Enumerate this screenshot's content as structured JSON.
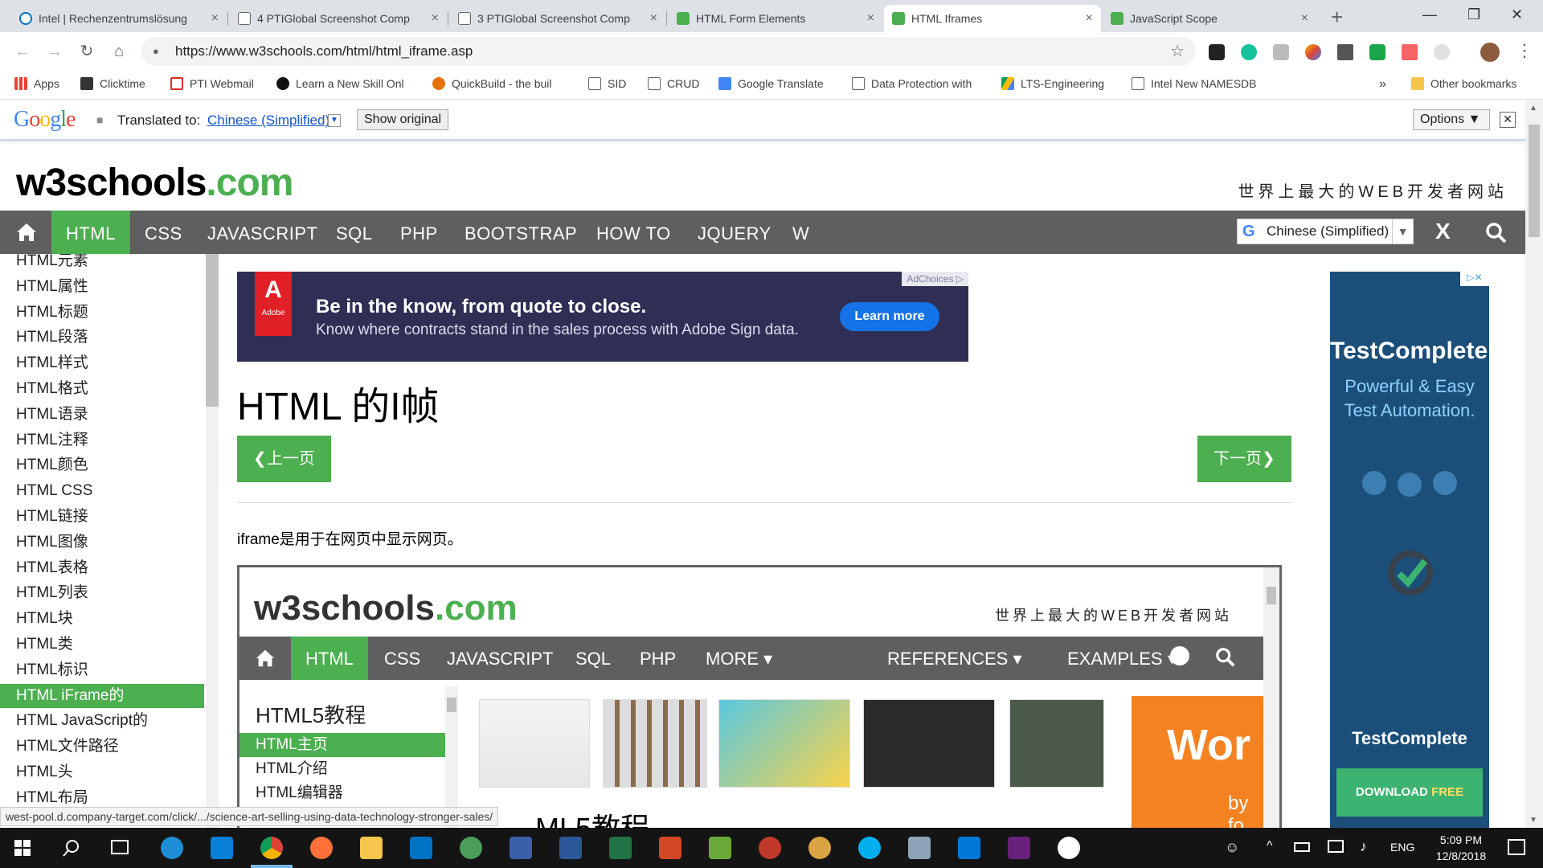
{
  "tabs": [
    {
      "label": "Intel | Rechenzentrumslösung",
      "color": "#0071c5"
    },
    {
      "label": "4 PTIGlobal Screenshot Comp",
      "color": "#888888"
    },
    {
      "label": "3 PTIGlobal Screenshot Comp",
      "color": "#888888"
    },
    {
      "label": "HTML Form Elements",
      "color": "#4caf50"
    },
    {
      "label": "HTML Iframes",
      "color": "#4caf50"
    },
    {
      "label": "JavaScript Scope",
      "color": "#4caf50"
    }
  ],
  "tab_close": "×",
  "new_tab": "+",
  "window_controls": {
    "minimize": "—",
    "maximize": "❐",
    "close": "✕"
  },
  "toolbar": {
    "back": "←",
    "forward": "→",
    "reload": "↻",
    "home": "⌂",
    "url": "https://www.w3schools.com/html/html_iframe.asp",
    "lock": "🔒",
    "star": "☆",
    "menu": "⋮"
  },
  "bookmarks": [
    {
      "label": "Apps",
      "color": "#ea4335"
    },
    {
      "label": "Clicktime",
      "color": "#333333"
    },
    {
      "label": "PTI Webmail",
      "color": "#d93025"
    },
    {
      "label": "Learn a New Skill Onl",
      "color": "#111111"
    },
    {
      "label": "QuickBuild - the buil",
      "color": "#e8710a"
    },
    {
      "label": "SID",
      "color": "#ffffff"
    },
    {
      "label": "CRUD",
      "color": "#ffffff"
    },
    {
      "label": "Google Translate",
      "color": "#4285f4"
    },
    {
      "label": "Data Protection with",
      "color": "#ffffff"
    },
    {
      "label": "LTS-Engineering",
      "color": "#fbbc04"
    },
    {
      "label": "Intel New NAMESDB",
      "color": "#ffffff"
    }
  ],
  "bookmarks_more": "»",
  "other_bookmarks": "Other bookmarks",
  "translate_bar": {
    "logo": "Google",
    "translated_to": "Translated to:",
    "language": "Chinese (Simplified)",
    "show_original": "Show original",
    "options": "Options ▼",
    "close": "✕"
  },
  "site": {
    "logo_main": "w3schools",
    "logo_dot": ".com",
    "slogan": "世界上最大的WEB开发者网站"
  },
  "topnav": [
    "HTML",
    "CSS",
    "JAVASCRIPT",
    "SQL",
    "PHP",
    "BOOTSTRAP",
    "HOW TO",
    "JQUERY",
    "W"
  ],
  "topnav_active": "HTML",
  "translate_select": {
    "g": "G",
    "label": "Chinese (Simplified)",
    "arrow": "▼"
  },
  "navx": "X",
  "sidebar": [
    "HTML元素",
    "HTML属性",
    "HTML标题",
    "HTML段落",
    "HTML样式",
    "HTML格式",
    "HTML语录",
    "HTML注释",
    "HTML颜色",
    "HTML CSS",
    "HTML链接",
    "HTML图像",
    "HTML表格",
    "HTML列表",
    "HTML块",
    "HTML类",
    "HTML标识",
    "HTML iFrame的",
    "HTML JavaScript的",
    "HTML文件路径",
    "HTML头",
    "HTML布局"
  ],
  "sidebar_active": "HTML iFrame的",
  "ad": {
    "logo": "Adobe",
    "headline": "Be in the know, from quote to close.",
    "subline": "Know where contracts stand in the sales process with Adobe Sign data.",
    "button": "Learn more",
    "adchoices": "AdChoices ▷"
  },
  "page_title": "HTML 的I帧",
  "prev_button": "❮上一页",
  "next_button": "下一页❯",
  "intro": "iframe是用于在网页中显示网页。",
  "iframe": {
    "logo_main": "w3schools",
    "logo_dot": ".com",
    "slogan": "世界上最大的WEB开发者网站",
    "nav": [
      "HTML",
      "CSS",
      "JAVASCRIPT",
      "SQL",
      "PHP",
      "MORE ▾",
      "REFERENCES ▾",
      "EXAMPLES ▾"
    ],
    "side_heading": "HTML5教程",
    "side_items": [
      "HTML主页",
      "HTML介绍",
      "HTML编辑器"
    ],
    "heading_partial": "ML5教程",
    "ad_partial": "Wor",
    "ad_sub": "by fo"
  },
  "right_ad": {
    "title": "TestComplete:",
    "subtitle": "Powerful & Easy Test Automation.",
    "brand": "TestComplete",
    "download_normal": "DOWNLOAD ",
    "download_bold": "FREE TRIAL",
    "badge": "▷✕"
  },
  "status_url": "west-pool.d.company-target.com/click/.../science-art-selling-using-data-technology-stronger-sales/",
  "taskbar": {
    "lang": "ENG",
    "time": "5:09 PM",
    "date": "12/8/2018"
  },
  "colors": {
    "accent": "#4caf50",
    "nav": "#5f5f5f",
    "link": "#1155cc"
  }
}
